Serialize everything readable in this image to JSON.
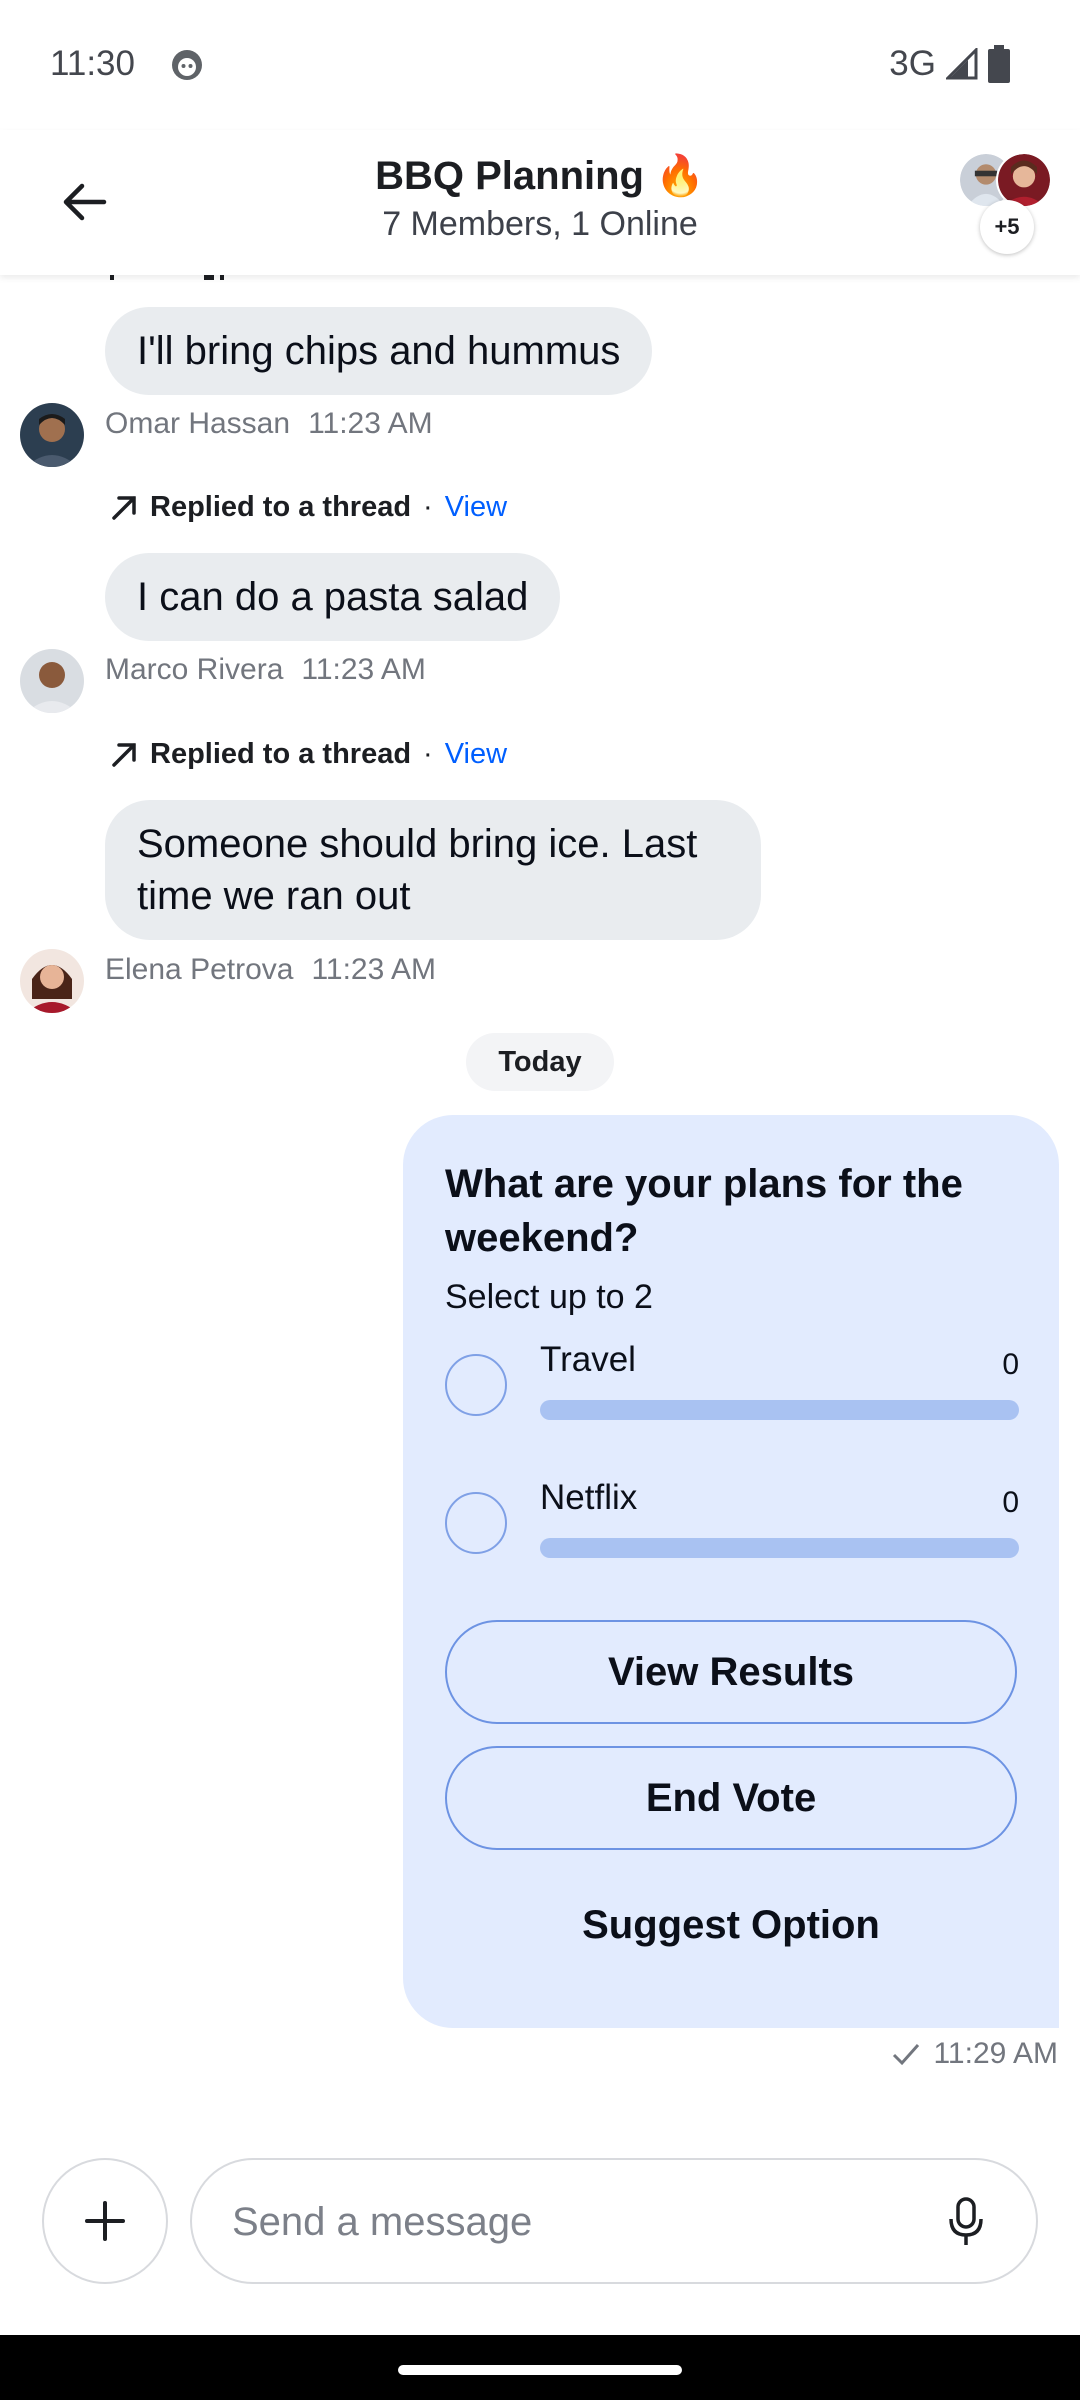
{
  "status_bar": {
    "time": "11:30",
    "network": "3G"
  },
  "header": {
    "title": "BBQ Planning 🔥",
    "subtitle": "7 Members, 1 Online",
    "extra_members": "+5"
  },
  "messages": [
    {
      "text": "I'll bring chips and hummus",
      "author": "Omar Hassan",
      "time": "11:23 AM"
    },
    {
      "thread_label": "Replied to a thread",
      "thread_sep": "·",
      "thread_view": "View",
      "text": "I can do a pasta salad",
      "author": "Marco Rivera",
      "time": "11:23 AM"
    },
    {
      "thread_label": "Replied to a thread",
      "thread_sep": "·",
      "thread_view": "View",
      "text": "Someone should bring ice. Last time we ran out",
      "author": "Elena Petrova",
      "time": "11:23 AM"
    }
  ],
  "date_separator": "Today",
  "poll": {
    "question": "What are your plans for the weekend?",
    "subtitle": "Select up to 2",
    "options": [
      {
        "label": "Travel",
        "votes": "0"
      },
      {
        "label": "Netflix",
        "votes": "0"
      }
    ],
    "view_results": "View Results",
    "end_vote": "End Vote",
    "suggest_option": "Suggest Option",
    "time": "11:29 AM"
  },
  "composer": {
    "placeholder": "Send a message"
  }
}
